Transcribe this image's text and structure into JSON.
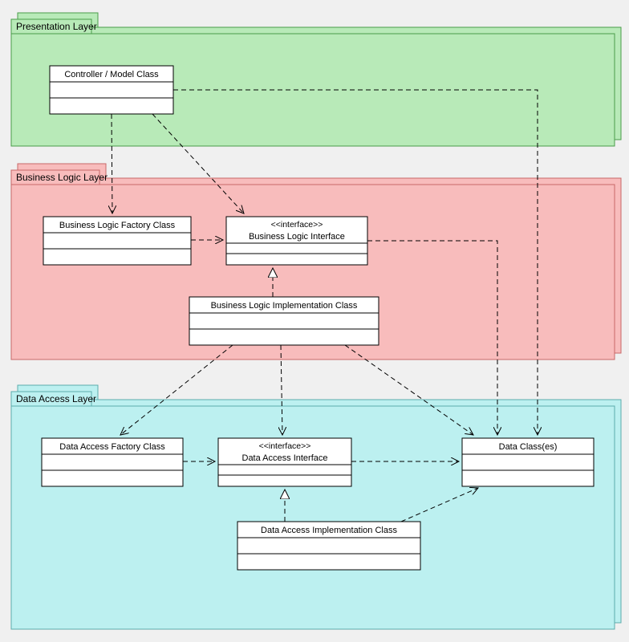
{
  "layers": {
    "presentation": {
      "title": "Presentation Layer",
      "color": "#b8eab8",
      "border": "#4a9c4a"
    },
    "business": {
      "title": "Business Logic Layer",
      "color": "#f8bcbc",
      "border": "#c86868"
    },
    "data": {
      "title": "Data Access Layer",
      "color": "#bcf0f0",
      "border": "#5cacac"
    }
  },
  "classes": {
    "controller": {
      "name": "Controller / Model Class"
    },
    "blFactory": {
      "name": "Business Logic Factory Class"
    },
    "blInterface": {
      "name": "Business Logic Interface",
      "stereotype": "<<interface>>"
    },
    "blImpl": {
      "name": "Business Logic Implementation Class"
    },
    "daFactory": {
      "name": "Data Access Factory Class"
    },
    "daInterface": {
      "name": "Data Access Interface",
      "stereotype": "<<interface>>"
    },
    "daImpl": {
      "name": "Data Access Implementation Class"
    },
    "dataClasses": {
      "name": "Data Class(es)"
    }
  }
}
